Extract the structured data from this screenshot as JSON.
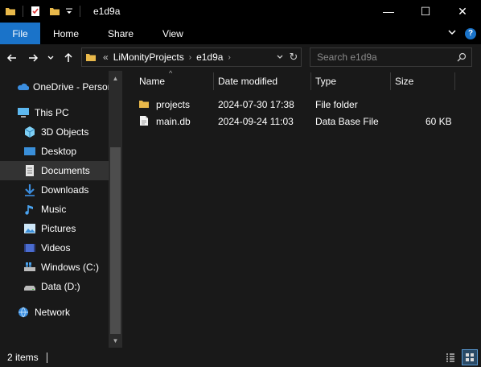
{
  "window": {
    "title": "e1d9a"
  },
  "window_controls": {
    "minimize": "—",
    "maximize": "☐",
    "close": "✕"
  },
  "ribbon": {
    "tabs": [
      "File",
      "Home",
      "Share",
      "View"
    ],
    "help": "?"
  },
  "address": {
    "prefix": "«",
    "segments": [
      "LiMonityProjects",
      "e1d9a"
    ],
    "dropdown": "⌄",
    "refresh": "↻"
  },
  "search": {
    "placeholder": "Search e1d9a"
  },
  "sidebar": {
    "items": [
      {
        "label": "OneDrive - Person",
        "icon": "onedrive-icon"
      },
      {
        "label": "This PC",
        "icon": "pc-icon"
      },
      {
        "label": "3D Objects",
        "icon": "3d-objects-icon"
      },
      {
        "label": "Desktop",
        "icon": "desktop-icon"
      },
      {
        "label": "Documents",
        "icon": "documents-icon",
        "selected": true
      },
      {
        "label": "Downloads",
        "icon": "downloads-icon"
      },
      {
        "label": "Music",
        "icon": "music-icon"
      },
      {
        "label": "Pictures",
        "icon": "pictures-icon"
      },
      {
        "label": "Videos",
        "icon": "videos-icon"
      },
      {
        "label": "Windows (C:)",
        "icon": "drive-c-icon"
      },
      {
        "label": "Data (D:)",
        "icon": "drive-d-icon"
      },
      {
        "label": "Network",
        "icon": "network-icon"
      }
    ]
  },
  "columns": {
    "name": "Name",
    "date": "Date modified",
    "type": "Type",
    "size": "Size"
  },
  "files": [
    {
      "name": "projects",
      "date": "2024-07-30 17:38",
      "type": "File folder",
      "size": "",
      "icon": "folder-icon"
    },
    {
      "name": "main.db",
      "date": "2024-09-24 11:03",
      "type": "Data Base File",
      "size": "60 KB",
      "icon": "file-icon"
    }
  ],
  "status": {
    "count": "2 items"
  },
  "colors": {
    "accent": "#1a73c9",
    "background": "#191919",
    "titlebar": "#000000",
    "folder": "#e8b84a",
    "selected": "#333333"
  }
}
